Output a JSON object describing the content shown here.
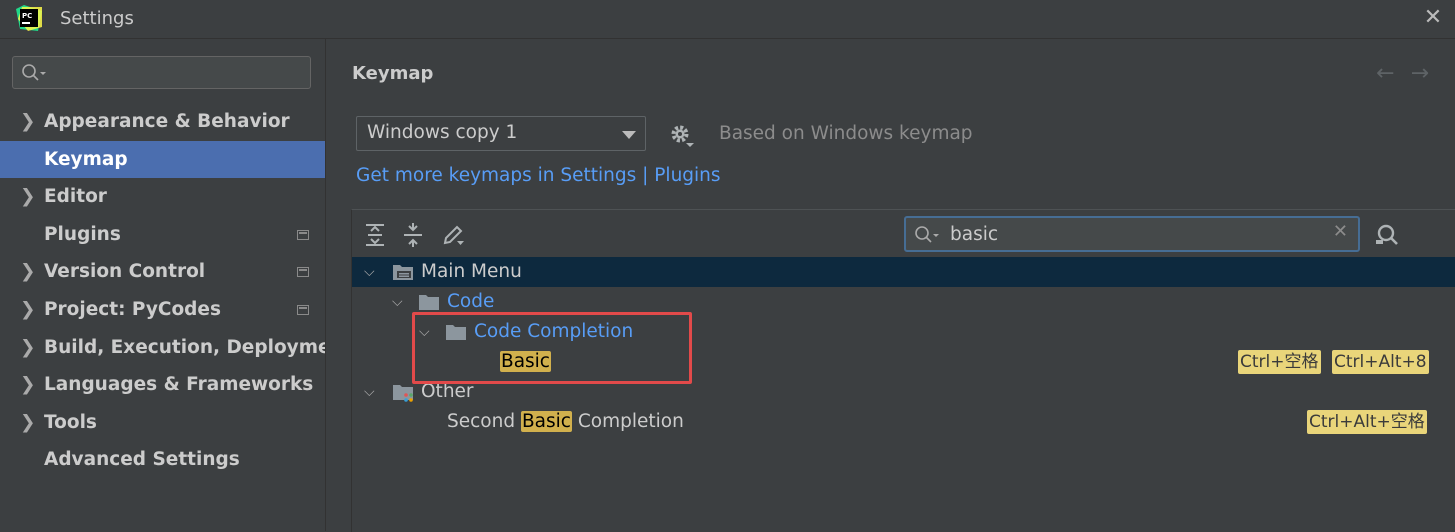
{
  "window": {
    "title": "Settings",
    "app_icon": "pycharm-icon",
    "close_icon": "close-icon"
  },
  "sidebar": {
    "search": {
      "value": "",
      "placeholder": ""
    },
    "items": [
      {
        "label": "Appearance & Behavior",
        "expandable": true,
        "selected": false,
        "project_badge": false
      },
      {
        "label": "Keymap",
        "expandable": false,
        "selected": true,
        "project_badge": false
      },
      {
        "label": "Editor",
        "expandable": true,
        "selected": false,
        "project_badge": false
      },
      {
        "label": "Plugins",
        "expandable": false,
        "selected": false,
        "project_badge": true
      },
      {
        "label": "Version Control",
        "expandable": true,
        "selected": false,
        "project_badge": true
      },
      {
        "label": "Project: PyCodes",
        "expandable": true,
        "selected": false,
        "project_badge": true
      },
      {
        "label": "Build, Execution, Deployment",
        "expandable": true,
        "selected": false,
        "project_badge": false
      },
      {
        "label": "Languages & Frameworks",
        "expandable": true,
        "selected": false,
        "project_badge": false
      },
      {
        "label": "Tools",
        "expandable": true,
        "selected": false,
        "project_badge": false
      },
      {
        "label": "Advanced Settings",
        "expandable": false,
        "selected": false,
        "project_badge": false
      }
    ]
  },
  "main": {
    "title": "Keymap",
    "back_icon": "arrow-left-icon",
    "forward_icon": "arrow-right-icon",
    "keymap_select": {
      "value": "Windows copy 1"
    },
    "based_on": "Based on Windows keymap",
    "link": "Get more keymaps in Settings | Plugins",
    "toolbar": {
      "expand_all_icon": "expand-all-icon",
      "collapse_all_icon": "collapse-all-icon",
      "edit_icon": "edit-icon"
    },
    "filter": {
      "value": "basic"
    },
    "tree": {
      "main_menu": "Main Menu",
      "code": "Code",
      "code_completion": "Code Completion",
      "basic": "Basic",
      "basic_shortcuts": [
        "Ctrl+空格",
        "Ctrl+Alt+8"
      ],
      "other": "Other",
      "second_prefix": "Second ",
      "second_match": "Basic",
      "second_suffix": " Completion",
      "second_shortcuts": [
        "Ctrl+Alt+空格"
      ]
    }
  },
  "colors": {
    "background": "#3c3f41",
    "selection": "#4b6eaf",
    "link": "#589df6",
    "highlight": "#d1b04d",
    "shortcut": "#e9d57a",
    "annotation": "#e24a4a"
  }
}
